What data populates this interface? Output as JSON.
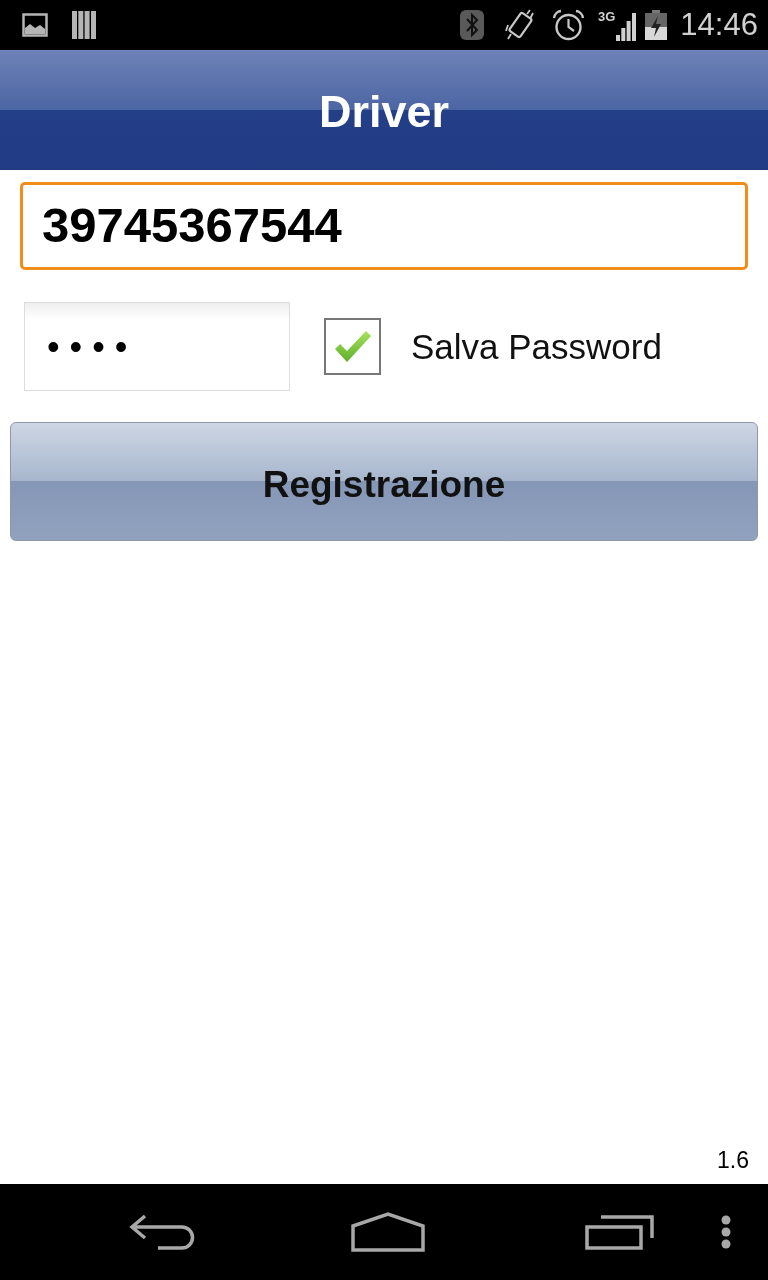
{
  "status_bar": {
    "network_type": "3G",
    "time": "14:46"
  },
  "app_bar": {
    "title": "Driver"
  },
  "form": {
    "phone_field": {
      "value": "39745367544",
      "focused": true
    },
    "password_field": {
      "value": "••••"
    },
    "save_password": {
      "label": "Salva Password",
      "checked": true
    },
    "register_button": {
      "label": "Registrazione"
    }
  },
  "version": "1.6"
}
